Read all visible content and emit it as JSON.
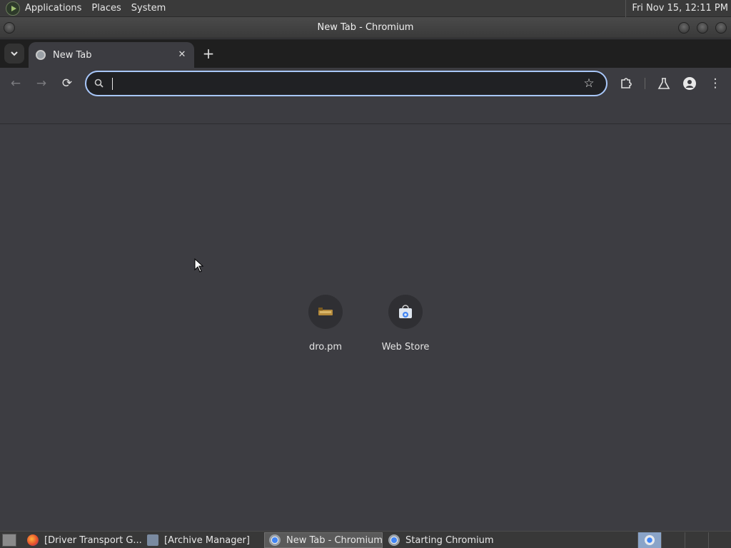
{
  "top_panel": {
    "menus": [
      "Applications",
      "Places",
      "System"
    ],
    "clock": "Fri Nov 15, 12:11 PM"
  },
  "window": {
    "title": "New Tab - Chromium"
  },
  "tabs": [
    {
      "label": "New Tab",
      "active": true
    }
  ],
  "toolbar": {
    "back": "←",
    "forward": "→",
    "reload": "⟳",
    "star": "☆",
    "menu": "⋮",
    "omnibox": {
      "value": "",
      "placeholder": ""
    }
  },
  "shortcuts": [
    {
      "name": "dro.pm",
      "icon": "dro-pm-icon"
    },
    {
      "name": "Web Store",
      "icon": "web-store-icon"
    }
  ],
  "taskbar": {
    "tasks": [
      {
        "label": "[Driver Transport G...",
        "icon": "firefox-icon",
        "active": false
      },
      {
        "label": "[Archive Manager]",
        "icon": "archive-manager-icon",
        "active": false
      },
      {
        "label": "New Tab - Chromium",
        "icon": "chromium-icon",
        "active": true
      },
      {
        "label": "Starting Chromium",
        "icon": "chromium-icon",
        "active": false
      }
    ]
  },
  "colors": {
    "omnibox_focus_border": "#a8c7fa",
    "background": "#3c3c41",
    "tabstrip": "#1f1f1f"
  }
}
